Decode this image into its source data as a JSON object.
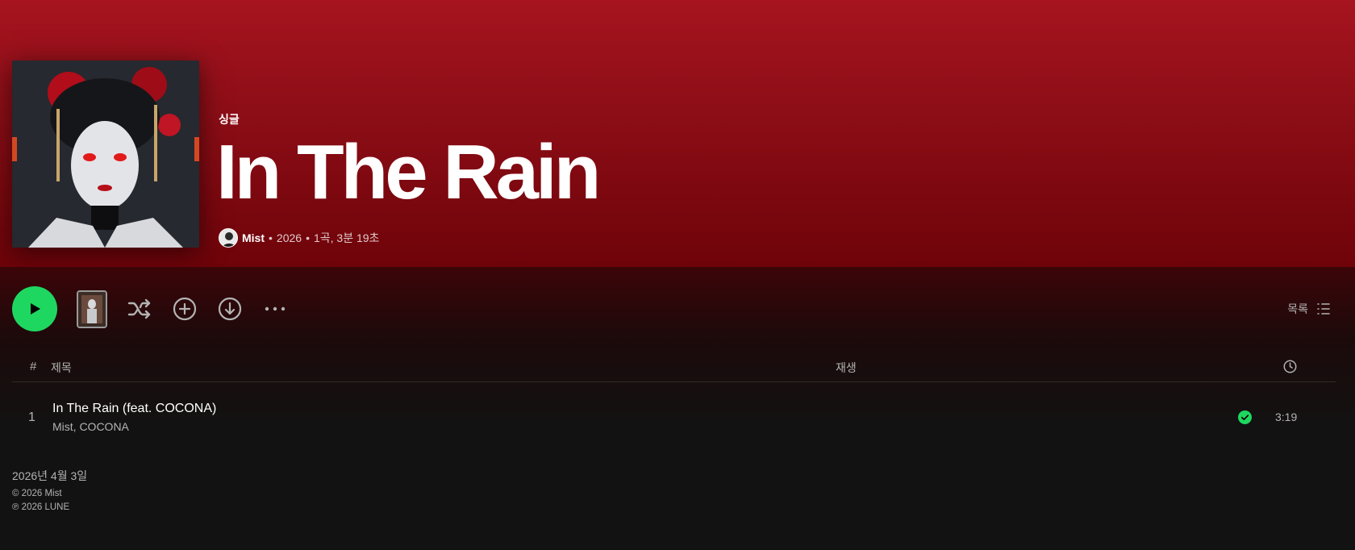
{
  "header": {
    "type_label": "싱글",
    "title": "In The Rain",
    "artist": "Mist",
    "year": "2026",
    "song_info": "1곡, 3분 19초",
    "separator": "•"
  },
  "actions": {
    "view_label": "목록"
  },
  "table": {
    "col_num": "#",
    "col_title": "제목",
    "col_plays": "재생",
    "rows": [
      {
        "num": "1",
        "title": "In The Rain (feat. COCONA)",
        "artists": "Mist, COCONA",
        "duration": "3:19"
      }
    ]
  },
  "footer": {
    "release_date": "2026년 4월 3일",
    "copyright": "© 2026 Mist",
    "phonogram": "℗ 2026 LUNE"
  },
  "colors": {
    "accent_green": "#1ed760",
    "hero_red": "#a6141f"
  },
  "icons": [
    "play-icon",
    "shuffle-icon",
    "add-icon",
    "download-icon",
    "more-icon",
    "list-view-icon",
    "clock-icon",
    "check-icon"
  ]
}
